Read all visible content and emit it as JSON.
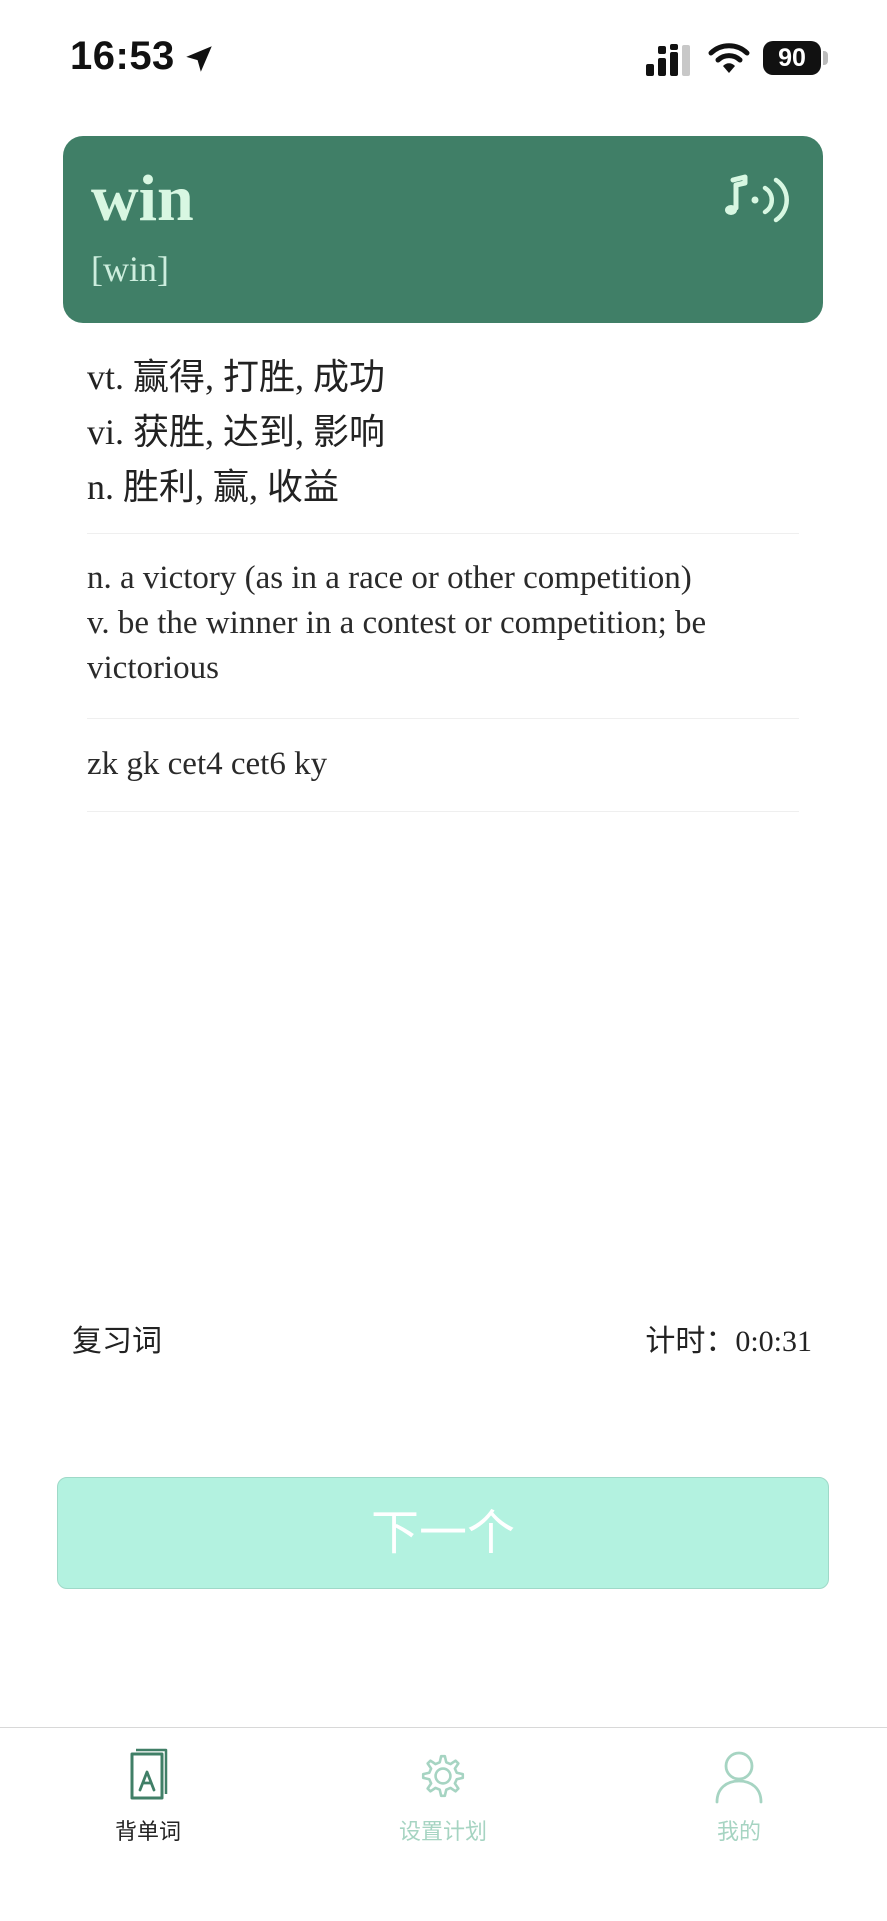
{
  "status_bar": {
    "time": "16:53",
    "battery": "90",
    "icons": [
      "location-arrow-icon",
      "signal-icon",
      "wifi-icon",
      "battery-icon"
    ]
  },
  "word_card": {
    "word": "win",
    "phonetic": "[win]",
    "audio_icon": "speaker-audio-icon",
    "background_color": "#407f67",
    "text_color": "#d8f7e2"
  },
  "chinese_definitions": [
    "vt. 赢得, 打胜, 成功",
    "vi. 获胜, 达到, 影响",
    "n. 胜利, 赢, 收益"
  ],
  "english_definitions": [
    "n. a victory (as in a race or other competition)",
    "v. be the winner in a contest or competition; be",
    "victorious"
  ],
  "tags": "zk gk cet4 cet6 ky",
  "review": {
    "label": "复习词",
    "timer_label": "计时：",
    "timer_value": "0:0:31"
  },
  "next_button": {
    "label": "下一个",
    "background_color": "#b3f2e0"
  },
  "tab_bar": {
    "tabs": [
      {
        "label": "背单词",
        "icon": "book-icon",
        "active": true
      },
      {
        "label": "设置计划",
        "icon": "gear-icon",
        "active": false
      },
      {
        "label": "我的",
        "icon": "user-icon",
        "active": false
      }
    ],
    "active_color": "#407f67",
    "inactive_color": "#a6d4c2"
  }
}
